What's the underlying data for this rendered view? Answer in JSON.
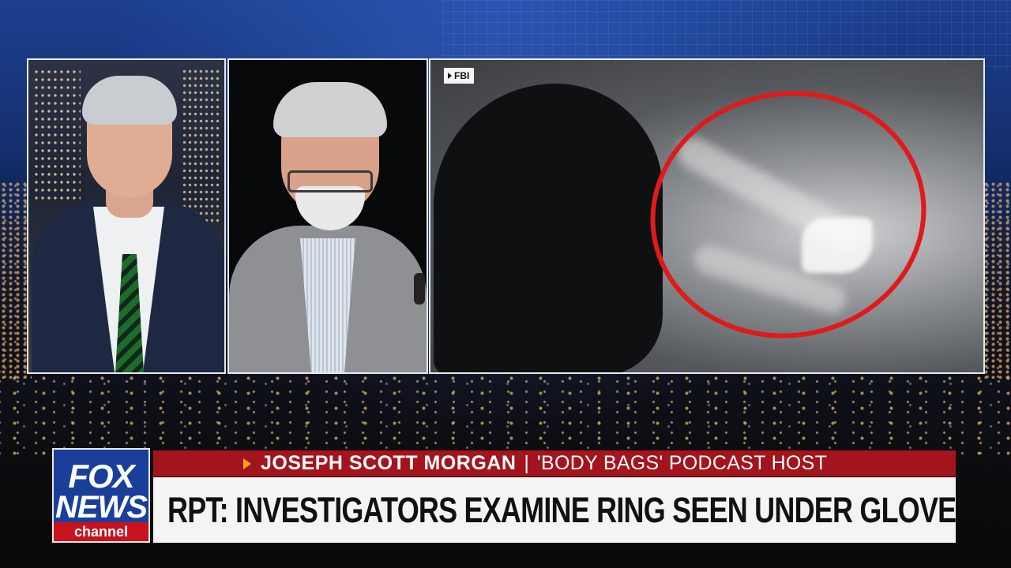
{
  "video": {
    "source_label": "FBI"
  },
  "lower_third": {
    "name": "JOSEPH SCOTT MORGAN",
    "separator": "|",
    "title": "'BODY BAGS' PODCAST HOST",
    "headline": "RPT: INVESTIGATORS EXAMINE RING SEEN UNDER GLOVE"
  },
  "logo": {
    "line1": "FOX",
    "line2": "NEWS",
    "line3": "channel"
  },
  "colors": {
    "lower_third_red": "#a3141d",
    "headline_bg": "#f4f4f4",
    "logo_blue": "#1a3f9a",
    "highlight_circle": "#e01a1a"
  }
}
